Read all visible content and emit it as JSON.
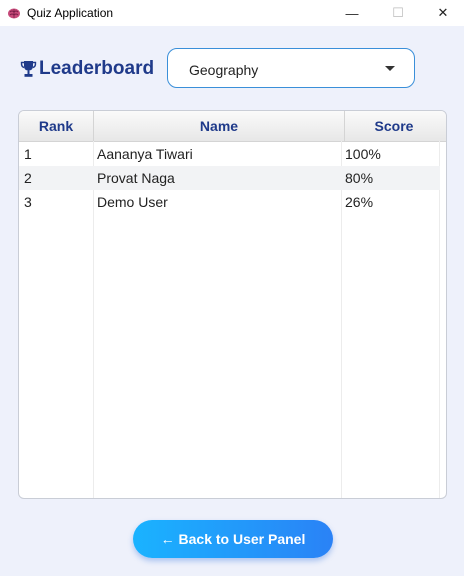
{
  "window": {
    "title": "Quiz Application",
    "icon": "brain-icon",
    "controls": {
      "minimize": "—",
      "maximize": "☐",
      "close": "✕"
    }
  },
  "header": {
    "icon": "trophy-icon",
    "title": "Leaderboard",
    "title_color": "#1f3a8a"
  },
  "category_select": {
    "value": "Geography",
    "border_color": "#3a8fd9"
  },
  "table": {
    "columns": [
      "Rank",
      "Name",
      "Score"
    ],
    "rows": [
      {
        "rank": "1",
        "name": "Aananya Tiwari",
        "score": "100%"
      },
      {
        "rank": "2",
        "name": "Provat Naga",
        "score": "80%"
      },
      {
        "rank": "3",
        "name": "Demo User",
        "score": "26%"
      }
    ]
  },
  "actions": {
    "back_label": "← Back to User Panel",
    "back_gradient": [
      "#1ab3ff",
      "#2a82f6"
    ]
  },
  "colors": {
    "background": "#eef1fb",
    "header_text": "#1f3a8a"
  }
}
